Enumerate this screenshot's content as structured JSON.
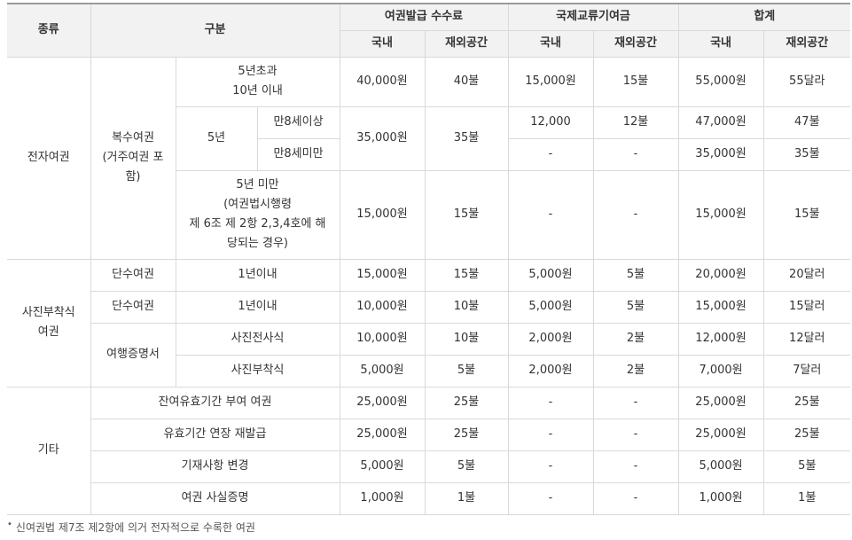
{
  "header": {
    "type": "종류",
    "category": "구분",
    "group_fee": "여권발급 수수료",
    "group_intl": "국제교류기여금",
    "group_total": "합계",
    "domestic": "국내",
    "overseas": "재외공간"
  },
  "cat": {
    "electronic": "전자여권",
    "multi_l1": "복수여권",
    "multi_l2": "(거주여권 포",
    "multi_l3": "함)",
    "photo_l1": "사진부착식",
    "photo_l2": "여권",
    "other": "기타",
    "over5_l1": "5년초과",
    "over5_l2": "10년 이내",
    "five": "5년",
    "age8_over": "만8세이상",
    "age8_under": "만8세미만",
    "under5_l1": "5년 미만",
    "under5_l2": "(여권법시행령",
    "under5_l3": "제 6조 제 2항 2,3,4호에 해",
    "under5_l4": "당되는 경우)",
    "single": "단수여권",
    "within1": "1년이내",
    "travel_cert": "여행증명서",
    "photo_print": "사진전사식",
    "photo_attach": "사진부착식",
    "remaining": "잔여유효기간 부여 여권",
    "extension": "유효기간 연장 재발급",
    "record_change": "기재사항 변경",
    "fact_cert": "여권 사실증명"
  },
  "rows": {
    "r1": [
      "40,000원",
      "40불",
      "15,000원",
      "15불",
      "55,000원",
      "55달라"
    ],
    "r2": [
      "35,000원",
      "35불",
      "12,000",
      "12불",
      "47,000원",
      "47불"
    ],
    "r3": [
      "-",
      "-",
      "35,000원",
      "35불"
    ],
    "r4": [
      "15,000원",
      "15불",
      "-",
      "-",
      "15,000원",
      "15불"
    ],
    "r5": [
      "15,000원",
      "15불",
      "5,000원",
      "5불",
      "20,000원",
      "20달러"
    ],
    "r6": [
      "10,000원",
      "10불",
      "5,000원",
      "5불",
      "15,000원",
      "15달러"
    ],
    "r7": [
      "10,000원",
      "10불",
      "2,000원",
      "2불",
      "12,000원",
      "12달러"
    ],
    "r8": [
      "5,000원",
      "5불",
      "2,000원",
      "2불",
      "7,000원",
      "7달러"
    ],
    "r9": [
      "25,000원",
      "25불",
      "-",
      "-",
      "25,000원",
      "25불"
    ],
    "r10": [
      "25,000원",
      "25불",
      "-",
      "-",
      "25,000원",
      "25불"
    ],
    "r11": [
      "5,000원",
      "5불",
      "-",
      "-",
      "5,000원",
      "5불"
    ],
    "r12": [
      "1,000원",
      "1불",
      "-",
      "-",
      "1,000원",
      "1불"
    ]
  },
  "footnote": {
    "bullet": "•",
    "text": "신여권법 제7조 제2항에 의거 전자적으로 수록한 여권"
  }
}
